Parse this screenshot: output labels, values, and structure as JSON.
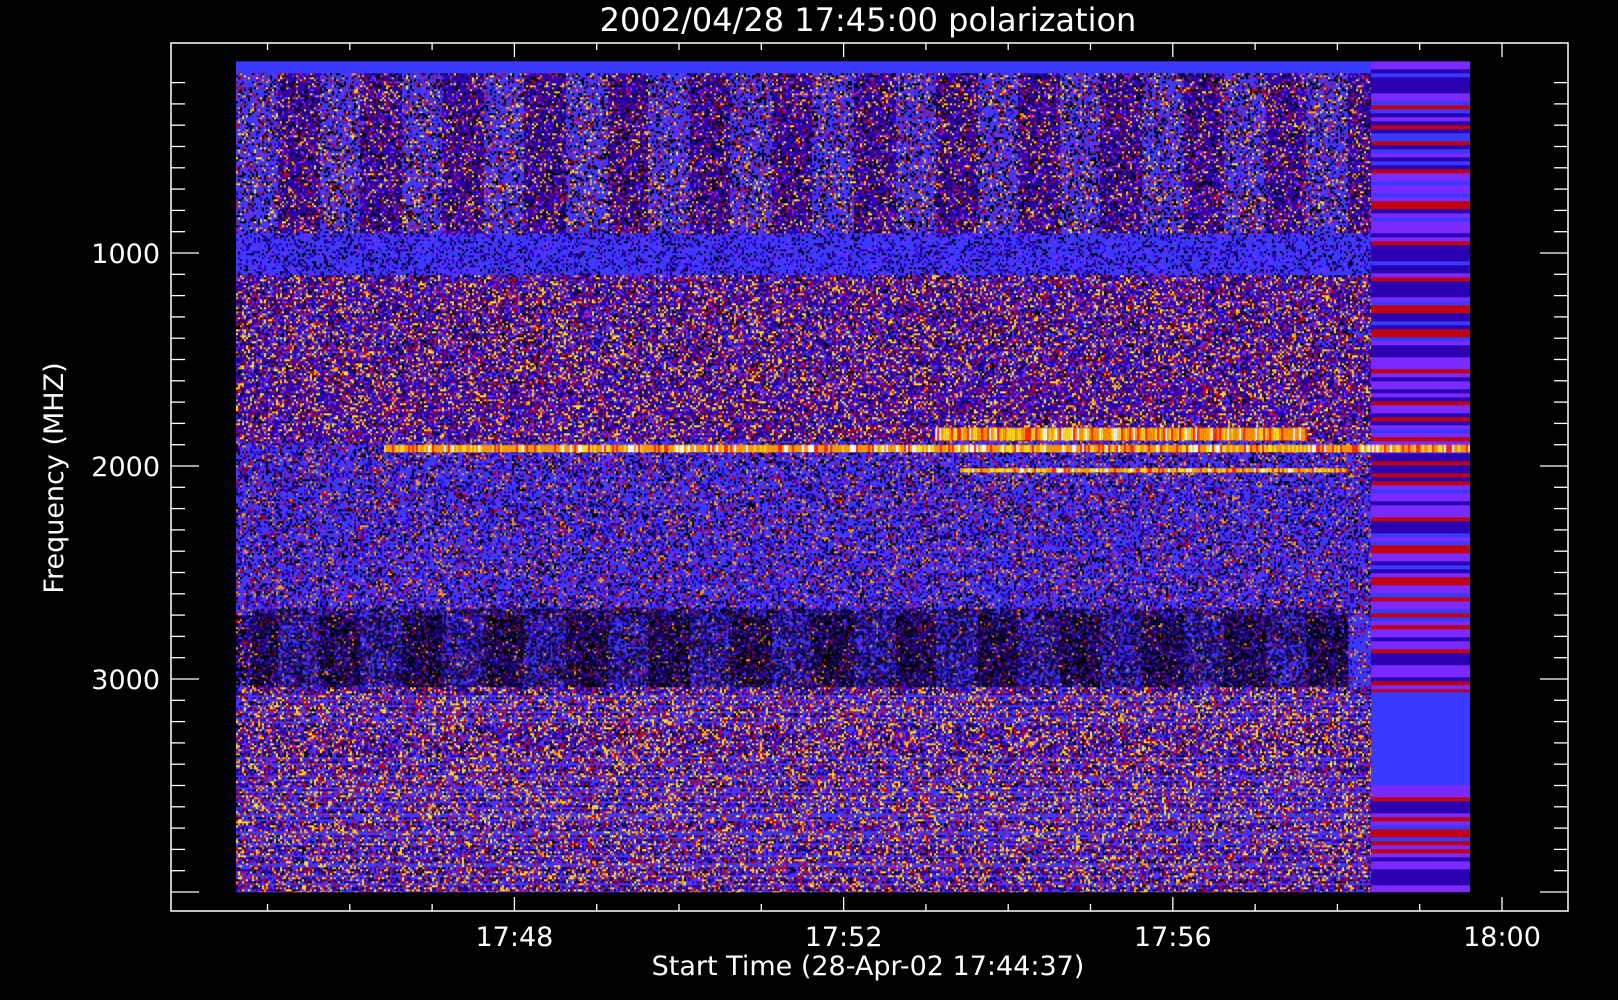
{
  "chart_data": {
    "type": "heatmap",
    "title": "2002/04/28 17:45:00 polarization",
    "xlabel": "Start Time (28-Apr-02 17:44:37)",
    "ylabel": "Frequency (MHZ)",
    "x_tick_labels": [
      "17:48",
      "17:52",
      "17:56",
      "18:00"
    ],
    "x_tick_values_min": [
      3.383,
      7.383,
      11.383,
      15.383
    ],
    "x_range_min": [
      0.0,
      15.383
    ],
    "y_tick_labels": [
      "1000",
      "2000",
      "3000"
    ],
    "y_tick_values": [
      1000,
      2000,
      3000
    ],
    "ylim": [
      4200,
      100
    ],
    "data_x_range_min": [
      0.0,
      15.0
    ],
    "data_y_range": [
      100,
      4000
    ],
    "colormap": [
      "#000000",
      "#2a00b0",
      "#3a3aff",
      "#7a2aff",
      "#c00010",
      "#ff2a00",
      "#ff9a00",
      "#ffe020",
      "#ffffff"
    ],
    "features": [
      {
        "name": "bright polarized band",
        "freq_mhz": [
          1900,
          1935
        ],
        "time_min": [
          1.8,
          15.0
        ],
        "level": "high"
      },
      {
        "name": "red band",
        "freq_mhz": [
          1820,
          1880
        ],
        "time_min": [
          8.5,
          13.0
        ],
        "level": "high"
      },
      {
        "name": "yellow band",
        "freq_mhz": [
          2010,
          2030
        ],
        "time_min": [
          8.8,
          13.5
        ],
        "level": "high"
      },
      {
        "name": "dark band",
        "freq_mhz": [
          2670,
          3030
        ],
        "time_min": [
          0.2,
          13.5
        ],
        "level": "low"
      },
      {
        "name": "blue block",
        "freq_mhz": [
          3060,
          3480
        ],
        "time_min": [
          13.8,
          15.0
        ],
        "level": "uniform"
      }
    ]
  }
}
